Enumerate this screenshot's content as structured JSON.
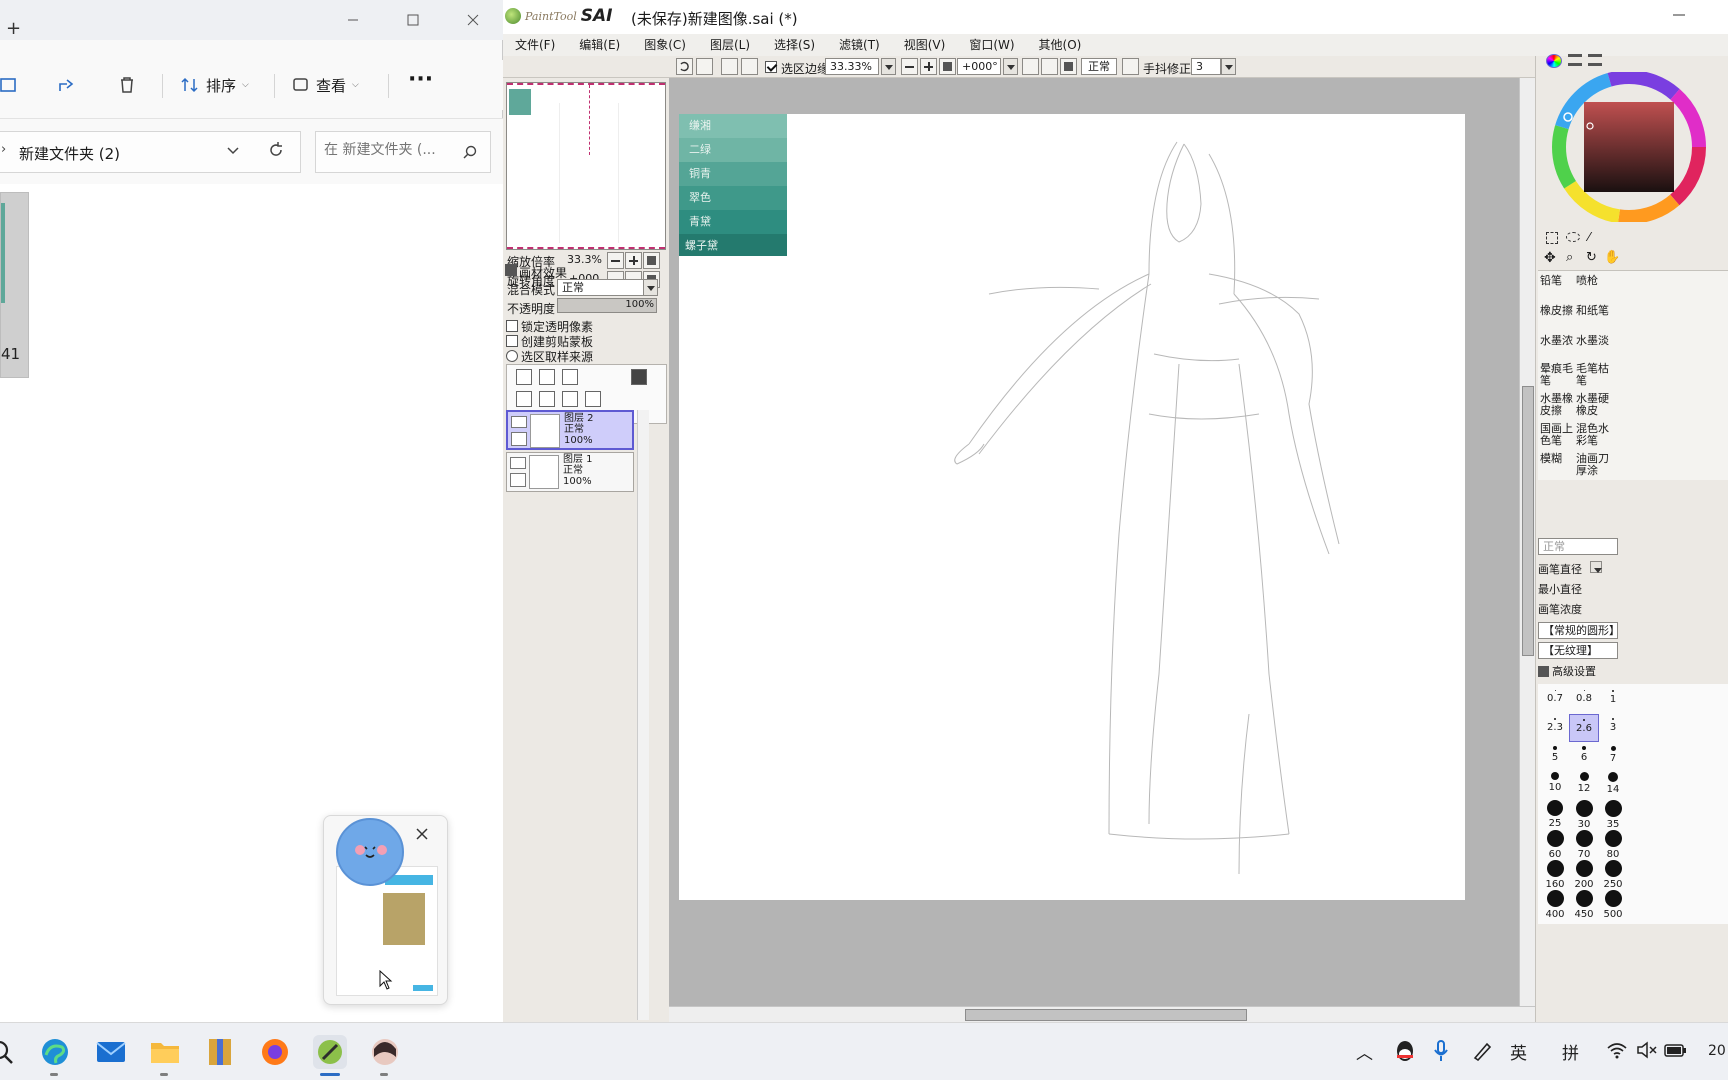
{
  "explorer": {
    "toolbar": {
      "sort_label": "排序",
      "view_label": "查看",
      "more_label": "···"
    },
    "address": {
      "breadcrumb": "新建文件夹 (2)"
    },
    "search": {
      "placeholder": "在 新建文件夹 (..."
    },
    "file": {
      "label": "41"
    }
  },
  "sai": {
    "logo": {
      "small": "PaintTool",
      "big": "SAI"
    },
    "title": "(未保存)新建图像.sai (*)",
    "menu": [
      "文件(F)",
      "编辑(E)",
      "图象(C)",
      "图层(L)",
      "选择(S)",
      "滤镜(T)",
      "视图(V)",
      "窗口(W)",
      "其他(O)"
    ],
    "toolbar": {
      "selection_edge_label": "选区边缘",
      "selection_edge_checked": true,
      "zoom": "33.33%",
      "rotation": "+000°",
      "blend": "正常",
      "stabilizer_label": "手抖修正",
      "stabilizer_value": "3"
    },
    "navigator": {
      "zoom_label": "缩放倍率",
      "zoom_value": "33.3%",
      "rotate_label": "旋转角度",
      "rotate_value": "+000"
    },
    "layer_props": {
      "effect_label": "画材效果",
      "blend_label": "混合模式",
      "blend_value": "正常",
      "opacity_label": "不透明度",
      "opacity_value": "100%",
      "lock_label": "锁定透明像素",
      "clip_label": "创建剪贴蒙板",
      "sample_label": "选区取样来源"
    },
    "layers": [
      {
        "name": "图层 2",
        "mode": "正常",
        "opacity": "100%",
        "selected": true
      },
      {
        "name": "图层 1",
        "mode": "正常",
        "opacity": "100%",
        "selected": false
      }
    ],
    "palette": [
      {
        "name": "缣湘",
        "color": "#7fbfb0"
      },
      {
        "name": "二绿",
        "color": "#6fb5a5"
      },
      {
        "name": "铜青",
        "color": "#54a596"
      },
      {
        "name": "翠色",
        "color": "#3f998a"
      },
      {
        "name": "青黛",
        "color": "#2e8d80"
      },
      {
        "name": "螺子黛",
        "color": "#247a6e"
      }
    ],
    "tools": [
      {
        "label": "铅笔"
      },
      {
        "label": "喷枪"
      },
      {
        "label": "橡皮擦"
      },
      {
        "label": "和纸笔"
      },
      {
        "label": "水墨浓"
      },
      {
        "label": "水墨淡"
      },
      {
        "label": "晕痕毛笔"
      },
      {
        "label": "毛笔枯笔"
      },
      {
        "label": "水墨橡皮擦"
      },
      {
        "label": "水墨硬橡皮"
      },
      {
        "label": "国画上色笔"
      },
      {
        "label": "混色水彩笔"
      },
      {
        "label": "模糊"
      },
      {
        "label": "油画刀厚涂"
      }
    ],
    "brush_props": {
      "mode": "正常",
      "size_label": "画笔直径",
      "min_label": "最小直径",
      "density_label": "画笔浓度",
      "shape": "【常规的圆形】",
      "texture": "【无纹理】",
      "advanced_label": "高级设置"
    },
    "sizes": [
      "0.7",
      "0.8",
      "1",
      "2.3",
      "2.6",
      "3",
      "5",
      "6",
      "7",
      "10",
      "12",
      "14",
      "25",
      "30",
      "35",
      "60",
      "70",
      "80",
      "160",
      "200",
      "250",
      "400",
      "450",
      "500"
    ],
    "selected_size": "2.6"
  },
  "taskbar": {
    "ime_lang": "英",
    "ime_mode": "拼",
    "clock": "20"
  }
}
